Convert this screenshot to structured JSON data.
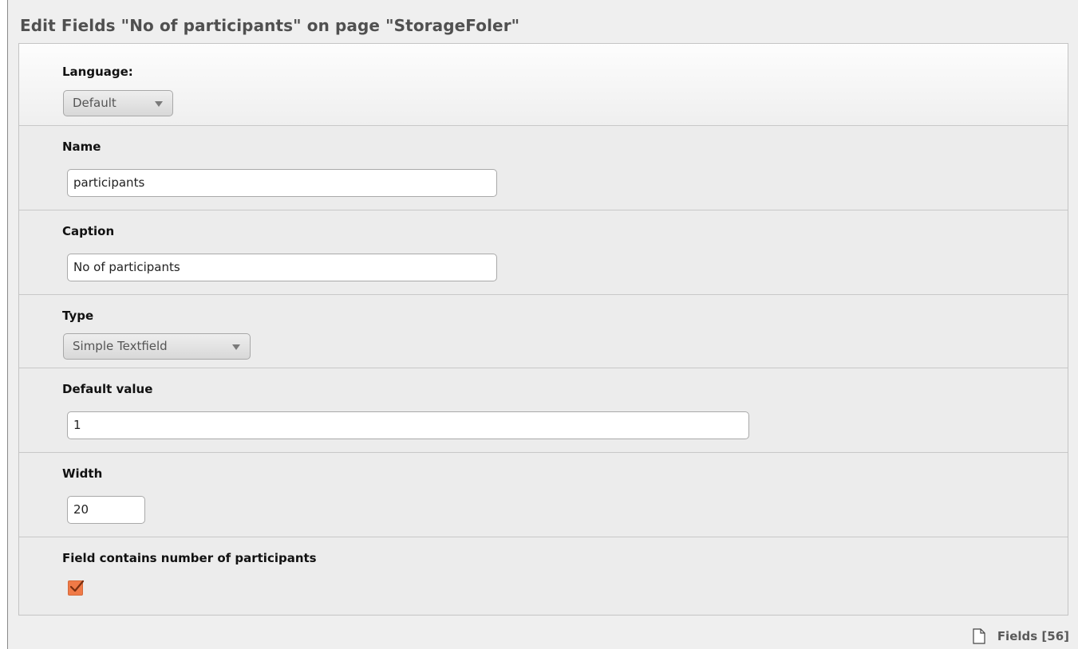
{
  "header": {
    "title": "Edit Fields \"No of participants\" on page \"StorageFoler\""
  },
  "language": {
    "label": "Language:",
    "selected": "Default"
  },
  "name": {
    "label": "Name",
    "value": "participants"
  },
  "caption": {
    "label": "Caption",
    "value": "No of participants"
  },
  "type": {
    "label": "Type",
    "selected": "Simple Textfield"
  },
  "default_value": {
    "label": "Default value",
    "value": "1"
  },
  "width": {
    "label": "Width",
    "value": "20"
  },
  "participants_flag": {
    "label": "Field contains number of participants",
    "checked": true
  },
  "footer": {
    "link_label": "Fields [56]",
    "icon": "document-icon"
  },
  "colors": {
    "checkbox_accent": "#f07a47",
    "title_text": "#505050"
  }
}
